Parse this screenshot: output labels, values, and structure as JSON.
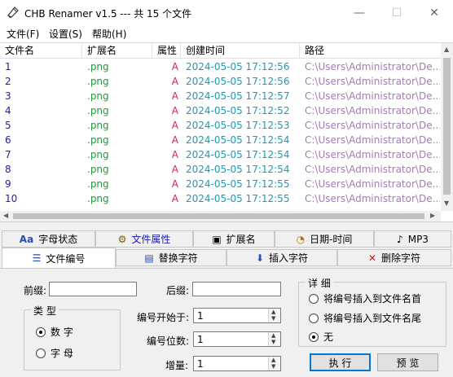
{
  "window": {
    "title": "CHB Renamer v1.5 --- 共 15 个文件",
    "minimize_glyph": "—",
    "maximize_glyph": "☐",
    "close_glyph": "✕"
  },
  "menu": {
    "file": "文件(F)",
    "settings": "设置(S)",
    "help": "帮助(H)"
  },
  "list": {
    "columns": [
      "文件名",
      "扩展名",
      "属性",
      "创建时间",
      "路径"
    ],
    "rows": [
      {
        "name": "1",
        "ext": ".png",
        "attr": "A",
        "time": "2024-05-05 17:12:56",
        "path": "C:\\Users\\Administrator\\De..."
      },
      {
        "name": "2",
        "ext": ".png",
        "attr": "A",
        "time": "2024-05-05 17:12:56",
        "path": "C:\\Users\\Administrator\\De..."
      },
      {
        "name": "3",
        "ext": ".png",
        "attr": "A",
        "time": "2024-05-05 17:12:57",
        "path": "C:\\Users\\Administrator\\De..."
      },
      {
        "name": "4",
        "ext": ".png",
        "attr": "A",
        "time": "2024-05-05 17:12:52",
        "path": "C:\\Users\\Administrator\\De..."
      },
      {
        "name": "5",
        "ext": ".png",
        "attr": "A",
        "time": "2024-05-05 17:12:53",
        "path": "C:\\Users\\Administrator\\De..."
      },
      {
        "name": "6",
        "ext": ".png",
        "attr": "A",
        "time": "2024-05-05 17:12:54",
        "path": "C:\\Users\\Administrator\\De..."
      },
      {
        "name": "7",
        "ext": ".png",
        "attr": "A",
        "time": "2024-05-05 17:12:54",
        "path": "C:\\Users\\Administrator\\De..."
      },
      {
        "name": "8",
        "ext": ".png",
        "attr": "A",
        "time": "2024-05-05 17:12:54",
        "path": "C:\\Users\\Administrator\\De..."
      },
      {
        "name": "9",
        "ext": ".png",
        "attr": "A",
        "time": "2024-05-05 17:12:55",
        "path": "C:\\Users\\Administrator\\De..."
      },
      {
        "name": "10",
        "ext": ".png",
        "attr": "A",
        "time": "2024-05-05 17:12:55",
        "path": "C:\\Users\\Administrator\\De..."
      }
    ]
  },
  "tabs_row1": [
    {
      "label": "字母状态",
      "icon": "Aa"
    },
    {
      "label": "文件属性",
      "icon": "⚙"
    },
    {
      "label": "扩展名",
      "icon": "▣"
    },
    {
      "label": "日期-时间",
      "icon": "◔"
    },
    {
      "label": "MP3",
      "icon": "♪"
    }
  ],
  "tabs_row2": [
    {
      "label": "文件编号",
      "icon": "☰"
    },
    {
      "label": "替换字符",
      "icon": "▤"
    },
    {
      "label": "插入字符",
      "icon": "⬇"
    },
    {
      "label": "删除字符",
      "icon": "✕"
    }
  ],
  "form": {
    "prefix_label": "前缀:",
    "suffix_label": "后缀:",
    "prefix_value": "",
    "suffix_value": "",
    "type_group": "类 型",
    "type_number": "数 字",
    "type_letter": "字 母",
    "start_label": "编号开始于:",
    "start_value": "1",
    "digits_label": "编号位数:",
    "digits_value": "1",
    "increment_label": "增量:",
    "increment_value": "1",
    "detail_group": "详 细",
    "opt_head": "将编号插入到文件名首",
    "opt_tail": "将编号插入到文件名尾",
    "opt_none": "无",
    "execute": "执 行",
    "preview": "预 览"
  },
  "colors": {
    "num": "#1a1ab8",
    "ext": "#1e9a3a",
    "attr": "#e0204a",
    "time": "#1e9ab5",
    "path": "#a779b9",
    "accent": "#0078d7"
  }
}
